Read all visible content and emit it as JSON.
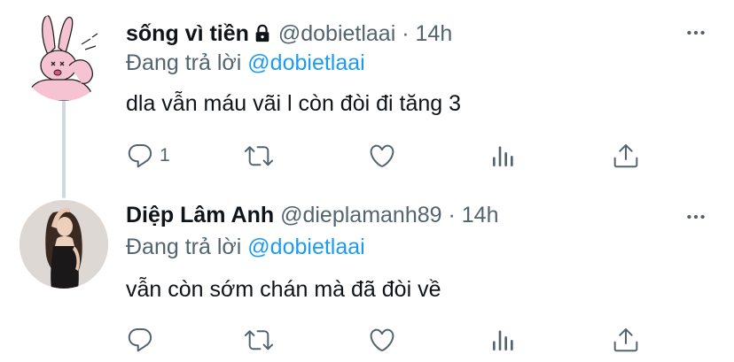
{
  "tweets": [
    {
      "name": "sống vì tiền",
      "handle": "@dobietlaai",
      "separator": "·",
      "time": "14h",
      "replying_prefix": "Đang trả lời",
      "replying_to": "@dobietlaai",
      "text": "dla vẫn máu vãi l còn đòi đi tăng 3",
      "reply_count": "1",
      "retweet_count": "",
      "like_count": "",
      "protected": true
    },
    {
      "name": "Diệp Lâm Anh",
      "handle": "@dieplamanh89",
      "separator": "·",
      "time": "14h",
      "replying_prefix": "Đang trả lời",
      "replying_to": "@dobietlaai",
      "text": "vẫn còn sớm chán mà đã đòi về",
      "reply_count": "",
      "retweet_count": "",
      "like_count": "",
      "protected": false
    }
  ],
  "icons": {
    "reply": "reply-icon",
    "retweet": "retweet-icon",
    "like": "heart-icon",
    "views": "views-icon",
    "share": "share-icon",
    "more": "more-icon",
    "lock": "lock-icon"
  },
  "colors": {
    "icon_gray": "#536471",
    "link_blue": "#1d9bf0",
    "thread_line": "#cfd9de",
    "avatar1_pink": "#f6c3d3"
  }
}
